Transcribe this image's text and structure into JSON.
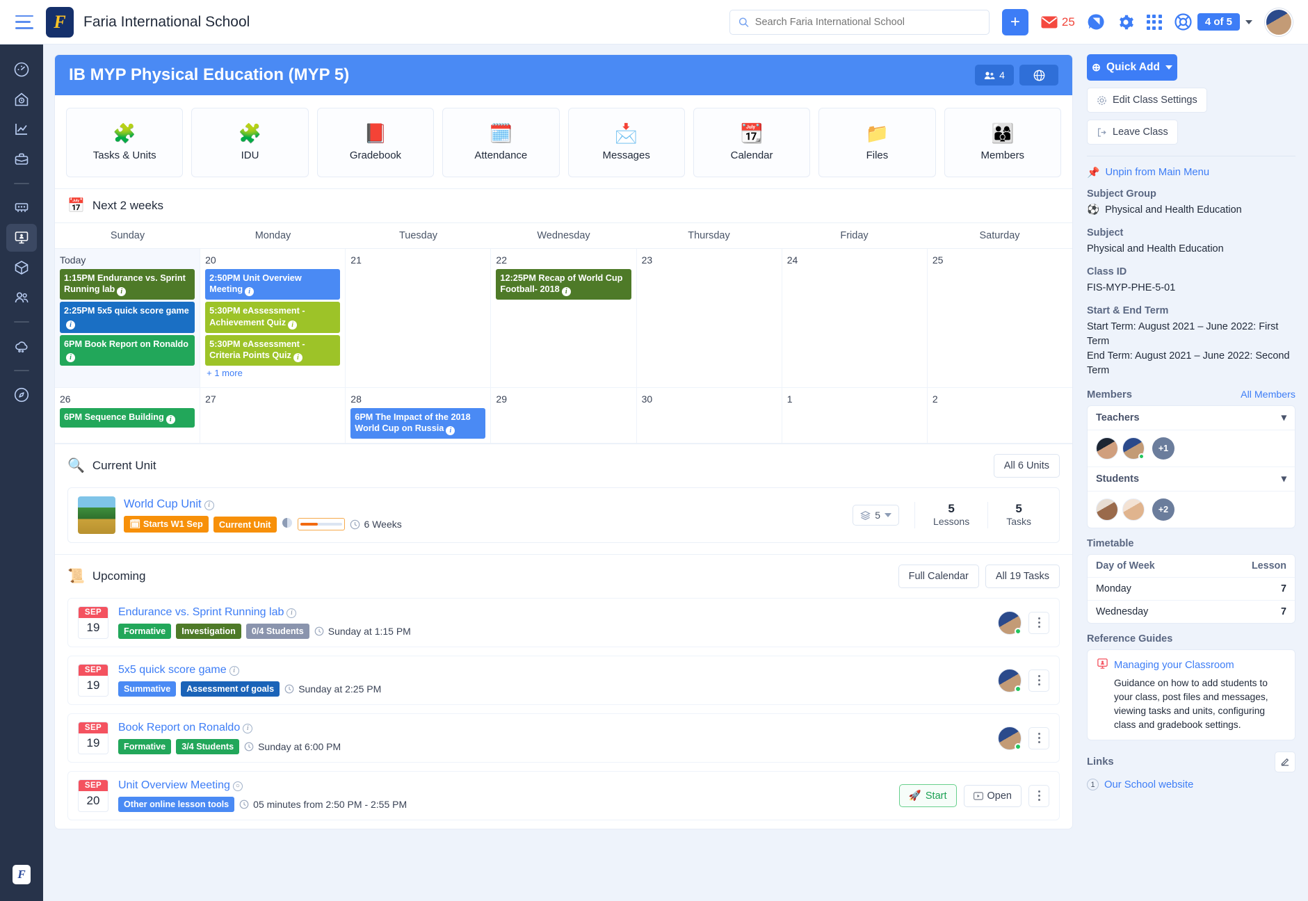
{
  "topbar": {
    "brand_letter": "F",
    "brand_name": "Faria International School",
    "search_placeholder": "Search Faria International School",
    "search_value": "",
    "add_label": "+",
    "mail_count": "25",
    "help_badge": "4 of 5"
  },
  "class": {
    "title": "IB MYP Physical Education (MYP 5)",
    "members_count": "4",
    "tiles": [
      {
        "label": "Tasks & Units",
        "icon": "puzzle-icon",
        "emoji": "🧩"
      },
      {
        "label": "IDU",
        "icon": "puzzle-multi-icon",
        "emoji": "🧩"
      },
      {
        "label": "Gradebook",
        "icon": "gradebook-icon",
        "emoji": "📕"
      },
      {
        "label": "Attendance",
        "icon": "attendance-icon",
        "emoji": "🗓️"
      },
      {
        "label": "Messages",
        "icon": "messages-icon",
        "emoji": "📩"
      },
      {
        "label": "Calendar",
        "icon": "calendar-icon",
        "emoji": "📆"
      },
      {
        "label": "Files",
        "icon": "files-icon",
        "emoji": "📁"
      },
      {
        "label": "Members",
        "icon": "members-icon",
        "emoji": "👨‍👩‍👦"
      }
    ]
  },
  "calendar": {
    "section_title": "Next 2 weeks",
    "day_names": [
      "Sunday",
      "Monday",
      "Tuesday",
      "Wednesday",
      "Thursday",
      "Friday",
      "Saturday"
    ],
    "week1": [
      {
        "date": "Today",
        "today": true,
        "events": [
          {
            "text": "1:15PM Endurance vs. Sprint Running lab",
            "color": "#4e7a28"
          },
          {
            "text": "2:25PM 5x5 quick score game",
            "color": "#1a6fc4"
          },
          {
            "text": "6PM Book Report on Ronaldo",
            "color": "#22a75a"
          }
        ],
        "more": ""
      },
      {
        "date": "20",
        "today": false,
        "events": [
          {
            "text": "2:50PM Unit Overview Meeting",
            "color": "#4a8af4"
          },
          {
            "text": "5:30PM eAssessment - Achievement Quiz",
            "color": "#9dc328"
          },
          {
            "text": "5:30PM eAssessment - Criteria Points Quiz",
            "color": "#9dc328"
          }
        ],
        "more": "+ 1 more"
      },
      {
        "date": "21",
        "today": false,
        "events": [],
        "more": ""
      },
      {
        "date": "22",
        "today": false,
        "events": [
          {
            "text": "12:25PM Recap of World Cup Football- 2018",
            "color": "#4e7a28"
          }
        ],
        "more": ""
      },
      {
        "date": "23",
        "today": false,
        "events": [],
        "more": ""
      },
      {
        "date": "24",
        "today": false,
        "events": [],
        "more": ""
      },
      {
        "date": "25",
        "today": false,
        "events": [],
        "more": ""
      }
    ],
    "week2": [
      {
        "date": "26",
        "today": false,
        "events": [
          {
            "text": "6PM Sequence Building",
            "color": "#22a75a"
          }
        ],
        "more": ""
      },
      {
        "date": "27",
        "today": false,
        "events": [],
        "more": ""
      },
      {
        "date": "28",
        "today": false,
        "events": [
          {
            "text": "6PM The Impact of the 2018 World Cup on Russia",
            "color": "#4a8af4"
          }
        ],
        "more": ""
      },
      {
        "date": "29",
        "today": false,
        "events": [],
        "more": ""
      },
      {
        "date": "30",
        "today": false,
        "events": [],
        "more": ""
      },
      {
        "date": "1",
        "today": false,
        "events": [],
        "more": ""
      },
      {
        "date": "2",
        "today": false,
        "events": [],
        "more": ""
      }
    ]
  },
  "current_unit": {
    "section_title": "Current Unit",
    "all_units_label": "All 6 Units",
    "unit_name": "World Cup Unit",
    "chip_starts": "Starts W1 Sep",
    "chip_current": "Current Unit",
    "duration": "6 Weeks",
    "layers_value": "5",
    "lessons_value": "5",
    "lessons_label": "Lessons",
    "tasks_value": "5",
    "tasks_label": "Tasks"
  },
  "upcoming": {
    "section_title": "Upcoming",
    "full_calendar_label": "Full Calendar",
    "all_tasks_label": "All 19 Tasks",
    "rows": [
      {
        "month": "SEP",
        "day": "19",
        "title": "Endurance vs. Sprint Running lab",
        "tags": [
          {
            "label": "Formative",
            "color": "#22a75a"
          },
          {
            "label": "Investigation",
            "color": "#4e7a28"
          },
          {
            "label": "0/4 Students",
            "color": "#8a94ad"
          }
        ],
        "time": "Sunday at 1:15 PM",
        "has_avatar": true,
        "has_start": false
      },
      {
        "month": "SEP",
        "day": "19",
        "title": "5x5 quick score game",
        "tags": [
          {
            "label": "Summative",
            "color": "#4a8af4"
          },
          {
            "label": "Assessment of goals",
            "color": "#1a63b8"
          }
        ],
        "time": "Sunday at 2:25 PM",
        "has_avatar": true,
        "has_start": false
      },
      {
        "month": "SEP",
        "day": "19",
        "title": "Book Report on Ronaldo",
        "tags": [
          {
            "label": "Formative",
            "color": "#22a75a"
          },
          {
            "label": "3/4 Students",
            "color": "#22a75a"
          }
        ],
        "time": "Sunday at 6:00 PM",
        "has_avatar": true,
        "has_start": false
      },
      {
        "month": "SEP",
        "day": "20",
        "title": "Unit Overview Meeting",
        "tags": [
          {
            "label": "Other online lesson tools",
            "color": "#4a8af4"
          }
        ],
        "time": "05 minutes from 2:50 PM - 2:55 PM",
        "has_avatar": false,
        "has_start": true,
        "start_label": "Start",
        "open_label": "Open"
      }
    ]
  },
  "sidebar": {
    "quick_add": "Quick Add",
    "edit_settings": "Edit Class Settings",
    "leave_class": "Leave Class",
    "unpin": "Unpin from Main Menu",
    "subject_group_label": "Subject Group",
    "subject_group_value": "Physical and Health Education",
    "subject_label": "Subject",
    "subject_value": "Physical and Health Education",
    "class_id_label": "Class ID",
    "class_id_value": "FIS-MYP-PHE-5-01",
    "term_label": "Start & End Term",
    "term_value": "Start Term: August 2021 – June 2022: First Term\nEnd Term: August 2021 – June 2022: Second Term",
    "members_label": "Members",
    "all_members_label": "All Members",
    "teachers_label": "Teachers",
    "teachers_extra": "+1",
    "students_label": "Students",
    "students_extra": "+2",
    "timetable_label": "Timetable",
    "timetable_head_day": "Day of Week",
    "timetable_head_lesson": "Lesson",
    "timetable_rows": [
      {
        "day": "Monday",
        "lesson": "7"
      },
      {
        "day": "Wednesday",
        "lesson": "7"
      }
    ],
    "reference_label": "Reference Guides",
    "reference_title": "Managing your Classroom",
    "reference_desc": "Guidance on how to add students to your class, post files and messages, viewing tasks and units, configuring class and gradebook settings.",
    "links_label": "Links",
    "link_number": "1",
    "link_text": "Our School website"
  },
  "rail": {
    "items": [
      {
        "name": "dashboard-icon"
      },
      {
        "name": "home-clock-icon"
      },
      {
        "name": "analytics-icon"
      },
      {
        "name": "briefcase-icon"
      },
      {
        "name": "classroom-icon"
      },
      {
        "name": "class-active-icon"
      },
      {
        "name": "cube-icon"
      },
      {
        "name": "people-icon"
      },
      {
        "name": "cloud-icon"
      },
      {
        "name": "compass-icon"
      }
    ]
  }
}
